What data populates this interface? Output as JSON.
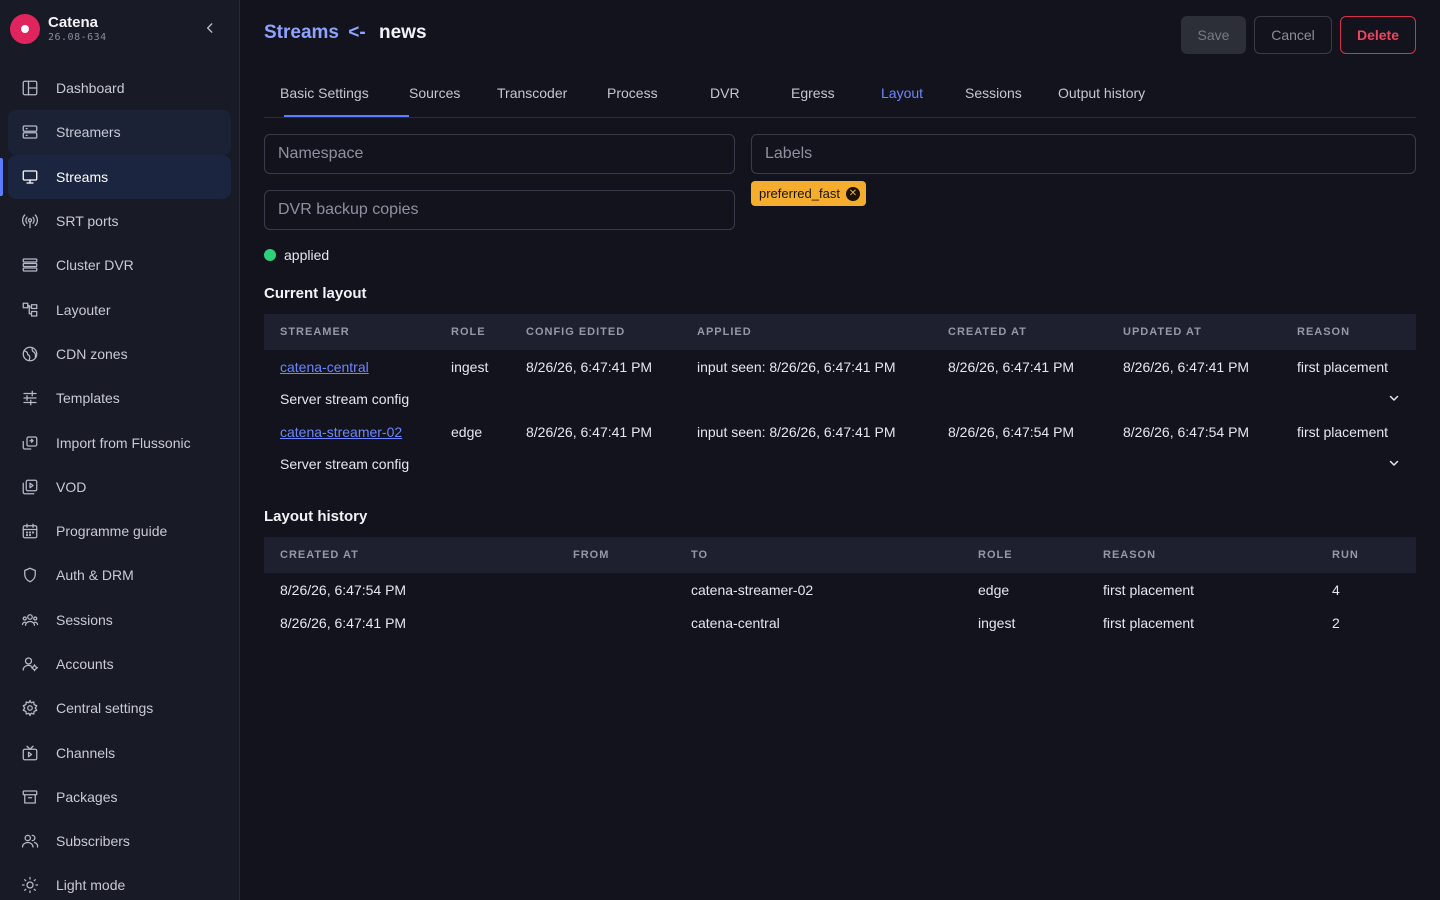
{
  "brand": {
    "name": "Catena",
    "version": "26.08-634"
  },
  "nav": [
    {
      "label": "Dashboard",
      "icon": "dashboard-icon"
    },
    {
      "label": "Streamers",
      "icon": "server-icon"
    },
    {
      "label": "Streams",
      "icon": "monitor-icon"
    },
    {
      "label": "SRT ports",
      "icon": "broadcast-icon"
    },
    {
      "label": "Cluster DVR",
      "icon": "storage-icon"
    },
    {
      "label": "Layouter",
      "icon": "layout-icon"
    },
    {
      "label": "CDN zones",
      "icon": "globe-icon"
    },
    {
      "label": "Templates",
      "icon": "sliders-icon"
    },
    {
      "label": "Import from Flussonic",
      "icon": "import-icon"
    },
    {
      "label": "VOD",
      "icon": "vod-icon"
    },
    {
      "label": "Programme guide",
      "icon": "calendar-icon"
    },
    {
      "label": "Auth & DRM",
      "icon": "shield-icon"
    },
    {
      "label": "Sessions",
      "icon": "users-icon"
    },
    {
      "label": "Accounts",
      "icon": "account-icon"
    },
    {
      "label": "Central settings",
      "icon": "gear-icon"
    },
    {
      "label": "Channels",
      "icon": "tv-icon"
    },
    {
      "label": "Packages",
      "icon": "archive-icon"
    },
    {
      "label": "Subscribers",
      "icon": "subscribers-icon"
    },
    {
      "label": "Light mode",
      "icon": "sun-icon"
    }
  ],
  "header": {
    "crumb": "Streams",
    "arrow": "<-",
    "name": "news"
  },
  "buttons": {
    "save": "Save",
    "cancel": "Cancel",
    "delete": "Delete"
  },
  "tabs": [
    "Basic Settings",
    "Sources",
    "Transcoder",
    "Process",
    "DVR",
    "Egress",
    "Layout",
    "Sessions",
    "Output history"
  ],
  "fields": {
    "namespace_placeholder": "Namespace",
    "labels_placeholder": "Labels",
    "dvr_placeholder": "DVR backup copies",
    "tag": "preferred_fast"
  },
  "status": "applied",
  "current_layout": {
    "title": "Current layout",
    "headers": [
      "STREAMER",
      "ROLE",
      "CONFIG EDITED",
      "APPLIED",
      "CREATED AT",
      "UPDATED AT",
      "REASON"
    ],
    "rows": [
      {
        "streamer": "catena-central",
        "role": "ingest",
        "config_edited": "8/26/26, 6:47:41 PM",
        "applied": "input seen: 8/26/26, 6:47:41 PM",
        "created_at": "8/26/26, 6:47:41 PM",
        "updated_at": "8/26/26, 6:47:41 PM",
        "reason": "first placement",
        "expand_label": "Server stream config"
      },
      {
        "streamer": "catena-streamer-02",
        "role": "edge",
        "config_edited": "8/26/26, 6:47:41 PM",
        "applied": "input seen: 8/26/26, 6:47:41 PM",
        "created_at": "8/26/26, 6:47:54 PM",
        "updated_at": "8/26/26, 6:47:54 PM",
        "reason": "first placement",
        "expand_label": "Server stream config"
      }
    ]
  },
  "layout_history": {
    "title": "Layout history",
    "headers": [
      "CREATED AT",
      "FROM",
      "TO",
      "ROLE",
      "REASON",
      "RUN"
    ],
    "rows": [
      {
        "created_at": "8/26/26, 6:47:54 PM",
        "from": "",
        "to": "catena-streamer-02",
        "role": "edge",
        "reason": "first placement",
        "run": "4"
      },
      {
        "created_at": "8/26/26, 6:47:41 PM",
        "from": "",
        "to": "catena-central",
        "role": "ingest",
        "reason": "first placement",
        "run": "2"
      }
    ]
  },
  "colors": {
    "accent": "#5b7cff",
    "danger": "#f0455e",
    "tag": "#f5ad2e",
    "status_ok": "#2bd27a",
    "brand": "#e0245e"
  }
}
